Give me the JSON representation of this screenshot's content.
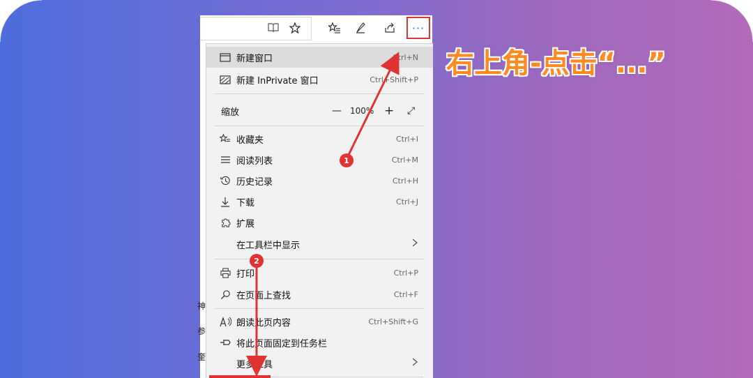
{
  "callout": {
    "text": "右上角-点击“...”"
  },
  "toolbar": {
    "reading_icon": "book-icon",
    "favorite_icon": "star-icon",
    "favorites_list_icon": "star-list-icon",
    "pen_icon": "pen-icon",
    "share_icon": "share-icon",
    "more_label": "···"
  },
  "page_fragments": [
    "神",
    "参",
    "奎"
  ],
  "menu": {
    "new_window": {
      "label": "新建窗口",
      "shortcut": "Ctrl+N"
    },
    "new_inprivate": {
      "label": "新建 InPrivate 窗口",
      "shortcut": "Ctrl+Shift+P"
    },
    "zoom": {
      "label": "缩放",
      "minus": "—",
      "value": "100%",
      "plus": "+",
      "fullscreen": "⤢"
    },
    "favorites": {
      "label": "收藏夹",
      "shortcut": "Ctrl+I"
    },
    "reading_list": {
      "label": "阅读列表",
      "shortcut": "Ctrl+M"
    },
    "history": {
      "label": "历史记录",
      "shortcut": "Ctrl+H"
    },
    "downloads": {
      "label": "下载",
      "shortcut": "Ctrl+J"
    },
    "extensions": {
      "label": "扩展"
    },
    "show_in_toolbar": {
      "label": "在工具栏中显示"
    },
    "print": {
      "label": "打印",
      "shortcut": "Ctrl+P"
    },
    "find": {
      "label": "在页面上查找",
      "shortcut": "Ctrl+F"
    },
    "read_aloud": {
      "label": "朗读此页内容",
      "shortcut": "Ctrl+Shift+G"
    },
    "pin_taskbar": {
      "label": "将此页面固定到任务栏"
    },
    "more_tools": {
      "label": "更多工具"
    }
  },
  "badges": {
    "step1": "1",
    "step2": "2"
  },
  "colors": {
    "accent_red": "#e03434",
    "callout_orange": "#ff8a1f",
    "more_dots_blue": "#2b6fd6"
  }
}
